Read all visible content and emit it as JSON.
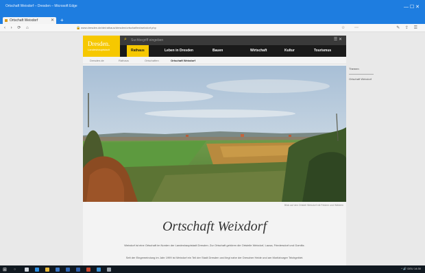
{
  "window": {
    "title": "Ortschaft Weixdorf – Dresden – Microsoft Edge",
    "controls": "—  ☐  ✕"
  },
  "tab": {
    "label": "Ortschaft Weixdorf",
    "new_tab": "+"
  },
  "addressbar": {
    "nav": "‹ › ⟳ ⌂",
    "url": "www.dresden.de/de/rathaus/dresden/ortschaften/weixdorf.php",
    "icons": "☆ ⋯",
    "tools": "✎ ⇪ ☰"
  },
  "site": {
    "logo_name": "Dresden.",
    "logo_sub": "Landeshauptstadt",
    "search_placeholder": "Suchbegriff eingeben",
    "search_right": "☰ ✕",
    "nav": [
      "Rathaus",
      "Leben in Dresden",
      "Bauen",
      "Wirtschaft",
      "Kultur",
      "Tourismus"
    ],
    "breadcrumb": [
      "Dresden.de",
      "Rathaus",
      "Ortschaften",
      "Ortschaft Weixdorf"
    ],
    "photo_caption": "Blick auf den Ortsteil Weixdorf mit Feldern und Wäldern",
    "title": "Ortschaft Weixdorf",
    "paragraph1": "Weixdorf ist eine Ortschaft im Norden der Landeshauptstadt Dresden. Zur Ortschaft gehören die Ortsteile Weixdorf, Lausa, Friedersdorf und Gomlitz.",
    "paragraph2": "Seit der Eingemeindung im Jahr 1999 ist Weixdorf ein Teil der Stadt Dresden und liegt nahe der Dresdner Heide und am Moritzburger Teichgebiet."
  },
  "sidepanel": {
    "title": "Themen",
    "link": "Ortschaft Weixdorf"
  },
  "taskbar": {
    "start": "⊞",
    "search": "○",
    "tray": "^ 🔊 DEU 14:30"
  },
  "colors": {
    "brand_yellow": "#f6c800",
    "header_dark": "#1a1a1a",
    "titlebar_blue": "#1e7de0"
  }
}
